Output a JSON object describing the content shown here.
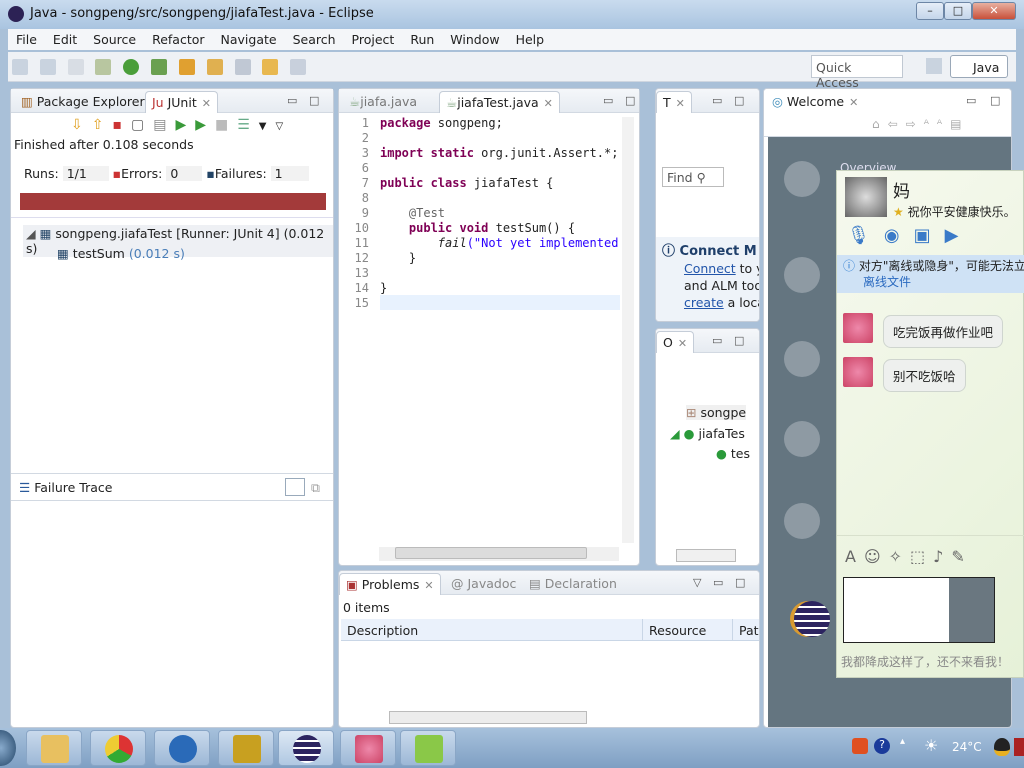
{
  "window": {
    "title": "Java - songpeng/src/songpeng/jiafaTest.java - Eclipse",
    "buttons": [
      "minimize",
      "maximize",
      "close"
    ]
  },
  "menu": [
    "File",
    "Edit",
    "Source",
    "Refactor",
    "Navigate",
    "Search",
    "Project",
    "Run",
    "Window",
    "Help"
  ],
  "toolbar": {
    "quick_access": "Quick Access",
    "perspective": "Java"
  },
  "left": {
    "tabs": [
      "Package Explorer",
      "JUnit"
    ],
    "status": "Finished after 0.108 seconds",
    "runs_label": "Runs:",
    "runs": "1/1",
    "errors_label": "Errors:",
    "errors": "0",
    "failures_label": "Failures:",
    "failures": "1",
    "progress": 1.0,
    "bar_color": "#a33a3a",
    "tree": [
      {
        "label": "songpeng.jiafaTest [Runner: JUnit 4] (0.012 s)"
      },
      {
        "label": "testSum",
        "time": "(0.012 s)"
      }
    ],
    "failure_trace": "Failure Trace"
  },
  "editor": {
    "tabs": [
      "jiafa.java",
      "jiafaTest.java"
    ],
    "line_numbers": [
      "1",
      "2",
      "3",
      "6",
      "7",
      "8",
      "9",
      "10",
      "11",
      "12",
      "13",
      "14",
      "15"
    ],
    "lines": [
      {
        "k": "package",
        "t": " songpeng;"
      },
      {
        "t": ""
      },
      {
        "k": "import static",
        "t": " org.junit.Assert.*;"
      },
      {
        "t": ""
      },
      {
        "k": "public class",
        "t": " jiafaTest {"
      },
      {
        "t": ""
      },
      {
        "a": "    @Test"
      },
      {
        "k": "    public void",
        "t": " testSum() {"
      },
      {
        "f": "        fail",
        "s": "(\"Not yet implemented\""
      },
      {
        "t": "    }"
      },
      {
        "t": ""
      },
      {
        "t": "}"
      },
      {
        "t": ""
      }
    ]
  },
  "task_panel": {
    "tab": "T",
    "find": "Find",
    "connect_title": "Connect M",
    "connect_link": "Connect",
    "connect_text1": " to y",
    "connect_text2": "and ALM too",
    "create_link": "create",
    "create_text": " a loca"
  },
  "outline": {
    "tab": "O",
    "items": [
      "songpe",
      "jiafaTes",
      "tes"
    ]
  },
  "welcome": {
    "tab": "Welcome",
    "overview": "Overview"
  },
  "problems": {
    "tabs": [
      "Problems",
      "Javadoc",
      "Declaration"
    ],
    "count": "0 items",
    "columns": [
      "Description",
      "Resource",
      "Pat"
    ]
  },
  "chat": {
    "name": "妈",
    "signature": "祝你平安健康快乐。",
    "notice": "对方\"离线或隐身\"，可能无法立",
    "notice_link": "离线文件",
    "messages": [
      "吃完饭再做作业吧",
      "别不吃饭哈"
    ],
    "caption": "我都降成这样了，还不来看我！"
  },
  "taskbar": {
    "temperature": "24°C"
  }
}
